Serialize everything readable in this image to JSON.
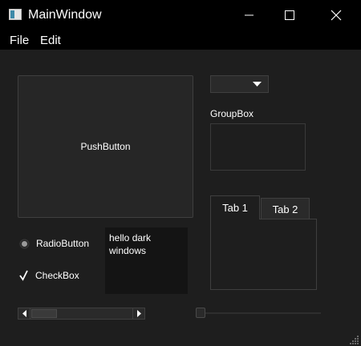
{
  "window": {
    "title": "MainWindow",
    "icons": {
      "app": "app-window-icon",
      "minimize": "minimize-icon",
      "maximize": "maximize-icon",
      "close": "close-icon"
    }
  },
  "menubar": {
    "items": [
      {
        "label": "File"
      },
      {
        "label": "Edit"
      }
    ]
  },
  "main": {
    "push_button": {
      "label": "PushButton"
    },
    "combo_box": {
      "value": "",
      "icon": "chevron-down-icon"
    },
    "group_box": {
      "title": "GroupBox"
    },
    "tabs": [
      {
        "label": "Tab 1",
        "selected": true
      },
      {
        "label": "Tab 2",
        "selected": false
      }
    ],
    "radio_button": {
      "label": "RadioButton",
      "checked": false
    },
    "check_box": {
      "label": "CheckBox",
      "checked": true
    },
    "text_edit": {
      "value": "hello dark\nwindows"
    },
    "scrollbar": {
      "orientation": "horizontal",
      "value": 0
    },
    "slider": {
      "orientation": "horizontal",
      "value": 0
    }
  },
  "colors": {
    "background": "#1e1e1e",
    "titlebar": "#000000",
    "text": "#ffffff",
    "border": "#3f3f3f"
  }
}
